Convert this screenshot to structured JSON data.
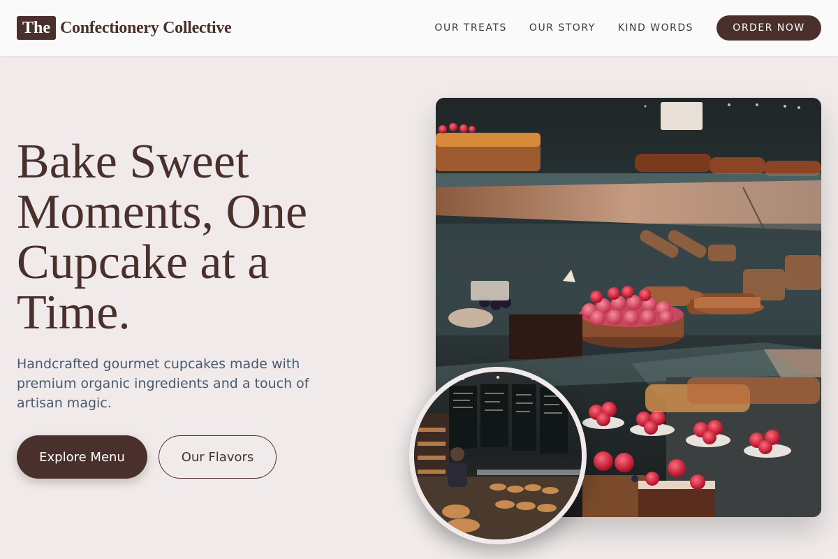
{
  "brand": {
    "mark": "The",
    "name": "Confectionery Collective"
  },
  "nav": {
    "links": [
      "OUR TREATS",
      "OUR STORY",
      "KIND WORDS"
    ],
    "cta": "ORDER NOW"
  },
  "hero": {
    "title": "Bake Sweet Moments, One Cupcake at a Time.",
    "subtitle": "Handcrafted gourmet cupcakes made with premium organic ingredients and a touch of artisan magic.",
    "primary_button": "Explore Menu",
    "secondary_button": "Our Flavors"
  },
  "colors": {
    "brand_brown": "#4a302c",
    "background": "#f0ebea",
    "header_bg": "#fafafa",
    "subtitle_text": "#4a5a6e"
  }
}
